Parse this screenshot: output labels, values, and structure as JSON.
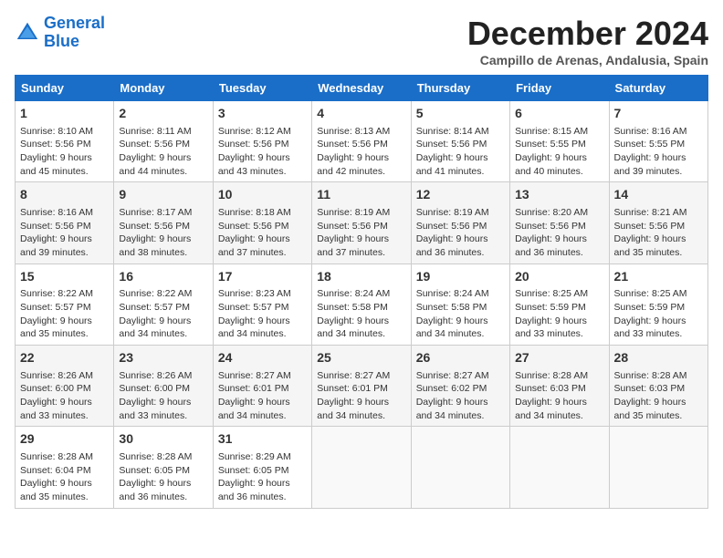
{
  "logo": {
    "line1": "General",
    "line2": "Blue"
  },
  "title": "December 2024",
  "location": "Campillo de Arenas, Andalusia, Spain",
  "days_of_week": [
    "Sunday",
    "Monday",
    "Tuesday",
    "Wednesday",
    "Thursday",
    "Friday",
    "Saturday"
  ],
  "weeks": [
    [
      {
        "day": "1",
        "lines": [
          "Sunrise: 8:10 AM",
          "Sunset: 5:56 PM",
          "Daylight: 9 hours",
          "and 45 minutes."
        ]
      },
      {
        "day": "2",
        "lines": [
          "Sunrise: 8:11 AM",
          "Sunset: 5:56 PM",
          "Daylight: 9 hours",
          "and 44 minutes."
        ]
      },
      {
        "day": "3",
        "lines": [
          "Sunrise: 8:12 AM",
          "Sunset: 5:56 PM",
          "Daylight: 9 hours",
          "and 43 minutes."
        ]
      },
      {
        "day": "4",
        "lines": [
          "Sunrise: 8:13 AM",
          "Sunset: 5:56 PM",
          "Daylight: 9 hours",
          "and 42 minutes."
        ]
      },
      {
        "day": "5",
        "lines": [
          "Sunrise: 8:14 AM",
          "Sunset: 5:56 PM",
          "Daylight: 9 hours",
          "and 41 minutes."
        ]
      },
      {
        "day": "6",
        "lines": [
          "Sunrise: 8:15 AM",
          "Sunset: 5:55 PM",
          "Daylight: 9 hours",
          "and 40 minutes."
        ]
      },
      {
        "day": "7",
        "lines": [
          "Sunrise: 8:16 AM",
          "Sunset: 5:55 PM",
          "Daylight: 9 hours",
          "and 39 minutes."
        ]
      }
    ],
    [
      {
        "day": "8",
        "lines": [
          "Sunrise: 8:16 AM",
          "Sunset: 5:56 PM",
          "Daylight: 9 hours",
          "and 39 minutes."
        ]
      },
      {
        "day": "9",
        "lines": [
          "Sunrise: 8:17 AM",
          "Sunset: 5:56 PM",
          "Daylight: 9 hours",
          "and 38 minutes."
        ]
      },
      {
        "day": "10",
        "lines": [
          "Sunrise: 8:18 AM",
          "Sunset: 5:56 PM",
          "Daylight: 9 hours",
          "and 37 minutes."
        ]
      },
      {
        "day": "11",
        "lines": [
          "Sunrise: 8:19 AM",
          "Sunset: 5:56 PM",
          "Daylight: 9 hours",
          "and 37 minutes."
        ]
      },
      {
        "day": "12",
        "lines": [
          "Sunrise: 8:19 AM",
          "Sunset: 5:56 PM",
          "Daylight: 9 hours",
          "and 36 minutes."
        ]
      },
      {
        "day": "13",
        "lines": [
          "Sunrise: 8:20 AM",
          "Sunset: 5:56 PM",
          "Daylight: 9 hours",
          "and 36 minutes."
        ]
      },
      {
        "day": "14",
        "lines": [
          "Sunrise: 8:21 AM",
          "Sunset: 5:56 PM",
          "Daylight: 9 hours",
          "and 35 minutes."
        ]
      }
    ],
    [
      {
        "day": "15",
        "lines": [
          "Sunrise: 8:22 AM",
          "Sunset: 5:57 PM",
          "Daylight: 9 hours",
          "and 35 minutes."
        ]
      },
      {
        "day": "16",
        "lines": [
          "Sunrise: 8:22 AM",
          "Sunset: 5:57 PM",
          "Daylight: 9 hours",
          "and 34 minutes."
        ]
      },
      {
        "day": "17",
        "lines": [
          "Sunrise: 8:23 AM",
          "Sunset: 5:57 PM",
          "Daylight: 9 hours",
          "and 34 minutes."
        ]
      },
      {
        "day": "18",
        "lines": [
          "Sunrise: 8:24 AM",
          "Sunset: 5:58 PM",
          "Daylight: 9 hours",
          "and 34 minutes."
        ]
      },
      {
        "day": "19",
        "lines": [
          "Sunrise: 8:24 AM",
          "Sunset: 5:58 PM",
          "Daylight: 9 hours",
          "and 34 minutes."
        ]
      },
      {
        "day": "20",
        "lines": [
          "Sunrise: 8:25 AM",
          "Sunset: 5:59 PM",
          "Daylight: 9 hours",
          "and 33 minutes."
        ]
      },
      {
        "day": "21",
        "lines": [
          "Sunrise: 8:25 AM",
          "Sunset: 5:59 PM",
          "Daylight: 9 hours",
          "and 33 minutes."
        ]
      }
    ],
    [
      {
        "day": "22",
        "lines": [
          "Sunrise: 8:26 AM",
          "Sunset: 6:00 PM",
          "Daylight: 9 hours",
          "and 33 minutes."
        ]
      },
      {
        "day": "23",
        "lines": [
          "Sunrise: 8:26 AM",
          "Sunset: 6:00 PM",
          "Daylight: 9 hours",
          "and 33 minutes."
        ]
      },
      {
        "day": "24",
        "lines": [
          "Sunrise: 8:27 AM",
          "Sunset: 6:01 PM",
          "Daylight: 9 hours",
          "and 34 minutes."
        ]
      },
      {
        "day": "25",
        "lines": [
          "Sunrise: 8:27 AM",
          "Sunset: 6:01 PM",
          "Daylight: 9 hours",
          "and 34 minutes."
        ]
      },
      {
        "day": "26",
        "lines": [
          "Sunrise: 8:27 AM",
          "Sunset: 6:02 PM",
          "Daylight: 9 hours",
          "and 34 minutes."
        ]
      },
      {
        "day": "27",
        "lines": [
          "Sunrise: 8:28 AM",
          "Sunset: 6:03 PM",
          "Daylight: 9 hours",
          "and 34 minutes."
        ]
      },
      {
        "day": "28",
        "lines": [
          "Sunrise: 8:28 AM",
          "Sunset: 6:03 PM",
          "Daylight: 9 hours",
          "and 35 minutes."
        ]
      }
    ],
    [
      {
        "day": "29",
        "lines": [
          "Sunrise: 8:28 AM",
          "Sunset: 6:04 PM",
          "Daylight: 9 hours",
          "and 35 minutes."
        ]
      },
      {
        "day": "30",
        "lines": [
          "Sunrise: 8:28 AM",
          "Sunset: 6:05 PM",
          "Daylight: 9 hours",
          "and 36 minutes."
        ]
      },
      {
        "day": "31",
        "lines": [
          "Sunrise: 8:29 AM",
          "Sunset: 6:05 PM",
          "Daylight: 9 hours",
          "and 36 minutes."
        ]
      },
      {
        "day": "",
        "lines": []
      },
      {
        "day": "",
        "lines": []
      },
      {
        "day": "",
        "lines": []
      },
      {
        "day": "",
        "lines": []
      }
    ]
  ]
}
